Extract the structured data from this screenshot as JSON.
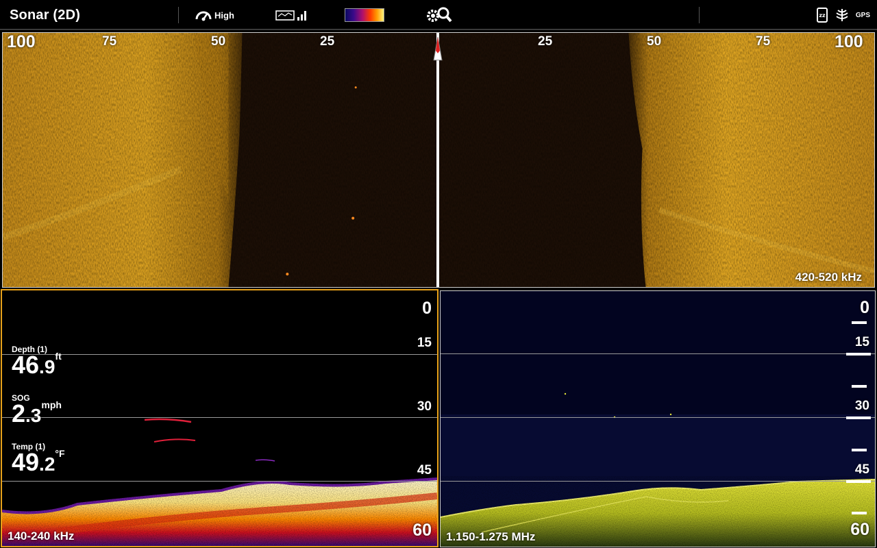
{
  "header": {
    "title": "Sonar (2D)",
    "speed_label": "High",
    "icons": [
      "speedometer-icon",
      "chart-sonar-icon",
      "color-palette-bar",
      "settings-zoom-icon",
      "sleep-icon",
      "sonar-icon",
      "gps-icon"
    ],
    "gps_label": "GPS"
  },
  "sidescan": {
    "range_left": [
      "100",
      "75",
      "50",
      "25"
    ],
    "range_right": [
      "25",
      "50",
      "75",
      "100"
    ],
    "frequency": "420-520 kHz"
  },
  "down_imaging": {
    "depth_scale": [
      "0",
      "15",
      "30",
      "45",
      "60"
    ],
    "frequency": "140-240 kHz",
    "readouts": [
      {
        "label": "Depth (1)",
        "int": "46",
        "dec": ".9",
        "unit": "ft"
      },
      {
        "label": "SOG",
        "int": "2",
        "dec": ".3",
        "unit": "mph"
      },
      {
        "label": "Temp (1)",
        "int": "49",
        "dec": ".2",
        "unit": "°F"
      }
    ]
  },
  "mega_imaging": {
    "depth_scale": [
      "0",
      "15",
      "30",
      "45",
      "60"
    ],
    "frequency": "1.150-1.275 MHz"
  },
  "colors": {
    "accent_border": "#e8a21a",
    "sidescan_tone": "#d9a020",
    "mega_tone": "#e8e83a"
  }
}
